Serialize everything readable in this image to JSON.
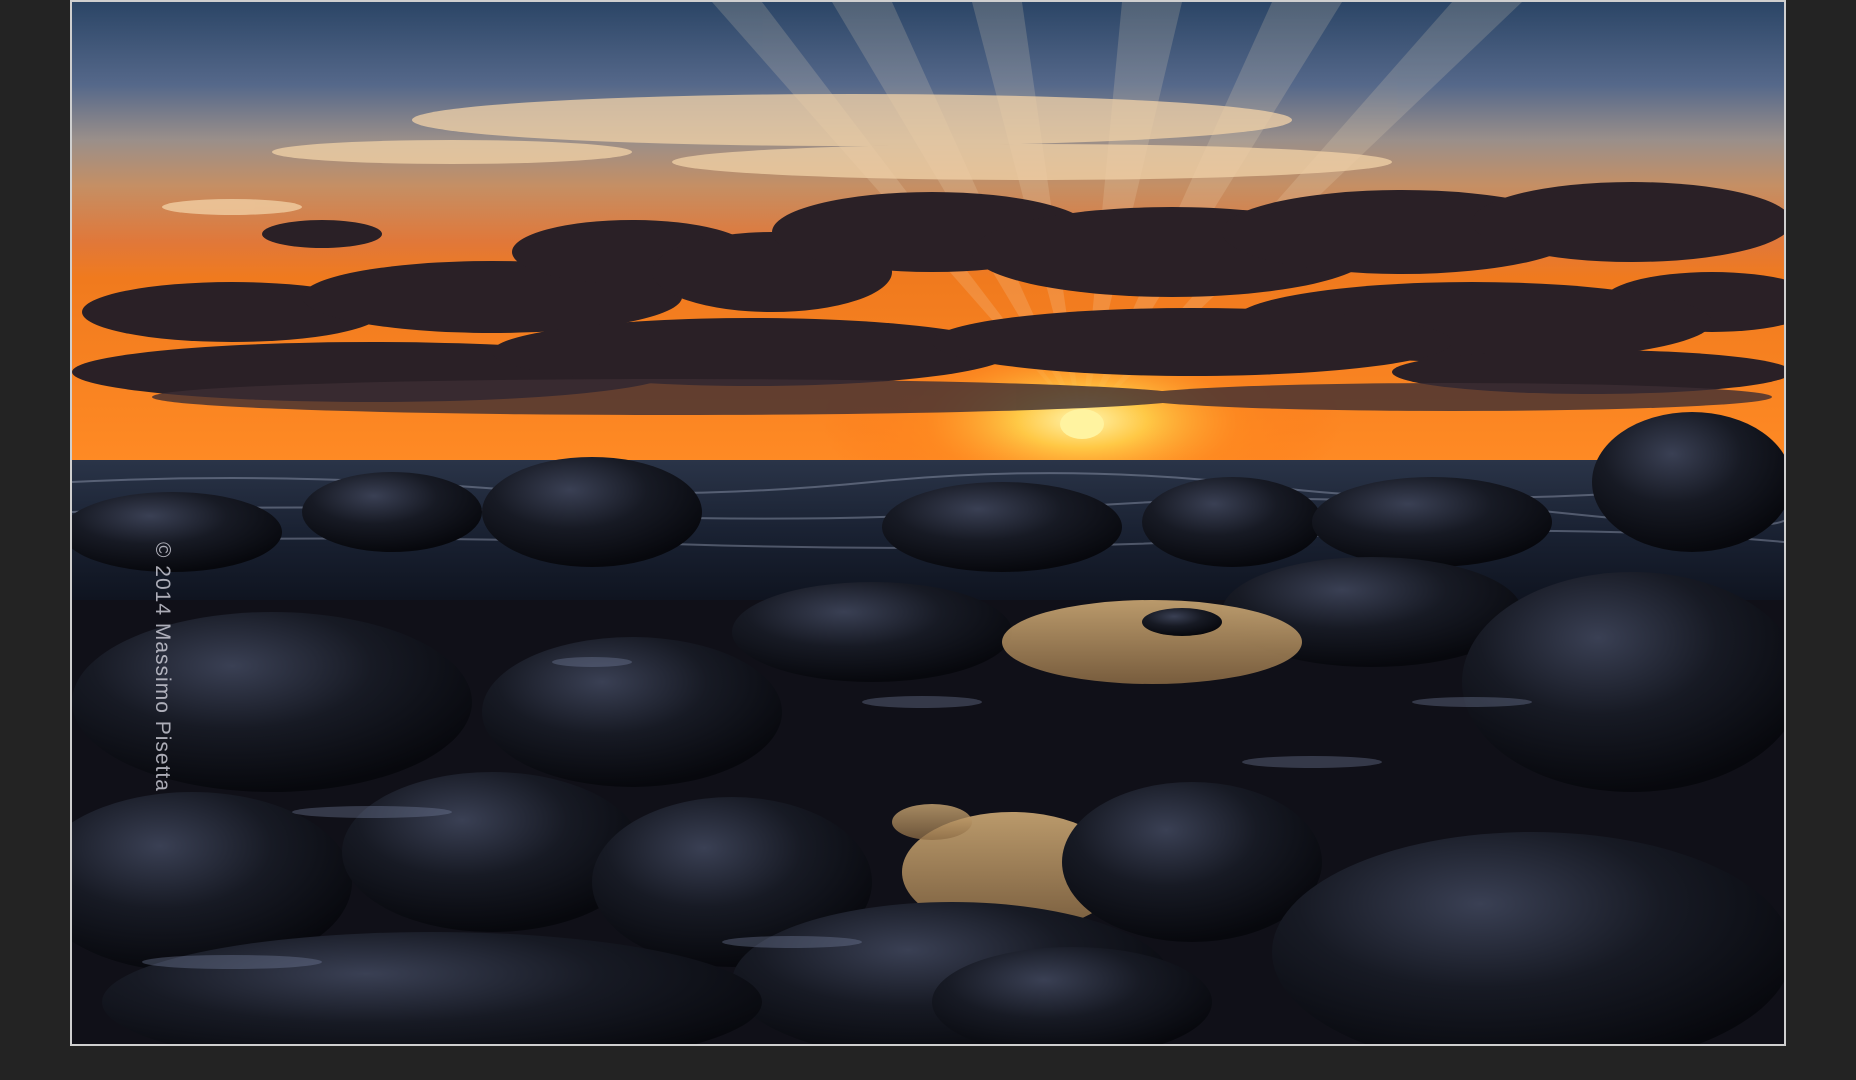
{
  "watermark": {
    "text": "© 2014 Massimo Pisetta"
  },
  "colors": {
    "page_background": "#232323",
    "frame_border": "#cfcfcf",
    "sky_top": "#2f4a6b",
    "sky_horizon": "#f07a1e",
    "sun": "#ffe36a",
    "rocks": "#0d0d14"
  },
  "photo": {
    "subject": "sunset over rocky shoreline"
  }
}
